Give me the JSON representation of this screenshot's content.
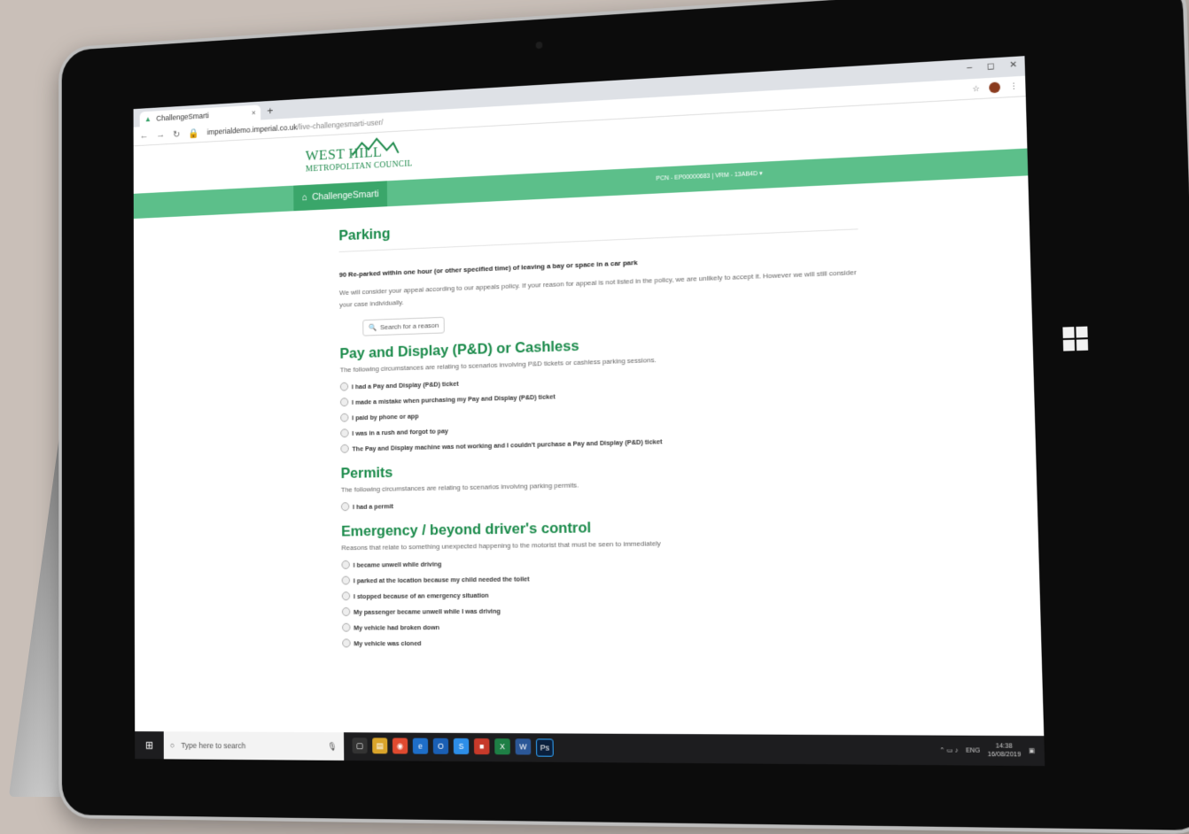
{
  "browser": {
    "tab_title": "ChallengeSmarti",
    "tab_close": "×",
    "new_tab": "+",
    "window_controls": [
      "–",
      "◻",
      "✕"
    ],
    "url_host": "imperialdemo.imperial.co.uk",
    "url_path": "/live-challengesmarti-user/",
    "avatar_initial": "S"
  },
  "site": {
    "logo_line1": "WEST HILL",
    "logo_line2": "METROPOLITAN COUNCIL",
    "brand": "ChallengeSmarti",
    "session": "PCN - EP00000683 | VRM - 13AB4D"
  },
  "page": {
    "title": "Parking",
    "reason_code": "90 Re-parked within one hour (or other specified time) of leaving a bay or space in a car park",
    "policy_text": "We will consider your appeal according to our appeals policy. If your reason for appeal is not listed in the policy, we are unlikely to accept it. However we will still consider your case individually.",
    "search_placeholder": "Search for a reason"
  },
  "categories": [
    {
      "title": "Pay and Display (P&D) or Cashless",
      "description": "The following circumstances are relating to scenarios involving P&D tickets or cashless parking sessions.",
      "options": [
        "I had a Pay and Display (P&D) ticket",
        "I made a mistake when purchasing my Pay and Display (P&D) ticket",
        "I paid by phone or app",
        "I was in a rush and forgot to pay",
        "The Pay and Display machine was not working and I couldn't purchase a Pay and Display (P&D) ticket"
      ]
    },
    {
      "title": "Permits",
      "description": "The following circumstances are relating to scenarios involving parking permits.",
      "options": [
        "I had a permit"
      ]
    },
    {
      "title": "Emergency / beyond driver's control",
      "description": "Reasons that relate to something unexpected happening to the motorist that must be seen to immediately",
      "options": [
        "I became unwell while driving",
        "I parked at the location because my child needed the toilet",
        "I stopped because of an emergency situation",
        "My passenger became unwell while I was driving",
        "My vehicle had broken down",
        "My vehicle was cloned"
      ]
    }
  ],
  "taskbar": {
    "search_placeholder": "Type here to search",
    "time": "14:38",
    "date": "16/08/2019",
    "lang": "ENG"
  },
  "colors": {
    "brand_green": "#5cbf8a",
    "heading_green": "#1a8a4a"
  }
}
